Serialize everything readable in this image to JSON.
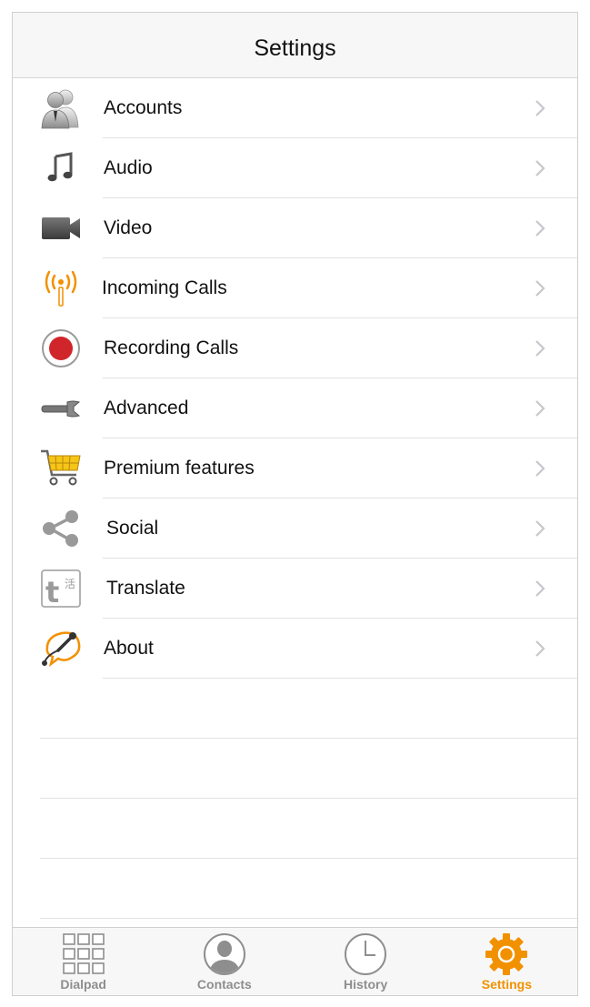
{
  "header": {
    "title": "Settings"
  },
  "menu": {
    "items": [
      {
        "label": "Accounts",
        "icon": "accounts-icon"
      },
      {
        "label": "Audio",
        "icon": "music-note-icon"
      },
      {
        "label": "Video",
        "icon": "video-camera-icon"
      },
      {
        "label": "Incoming Calls",
        "icon": "antenna-icon"
      },
      {
        "label": "Recording Calls",
        "icon": "record-icon"
      },
      {
        "label": "Advanced",
        "icon": "wrench-icon"
      },
      {
        "label": "Premium features",
        "icon": "shopping-cart-icon"
      },
      {
        "label": "Social",
        "icon": "share-icon"
      },
      {
        "label": "Translate",
        "icon": "translate-icon"
      },
      {
        "label": "About",
        "icon": "about-logo-icon"
      }
    ]
  },
  "tabs": [
    {
      "label": "Dialpad",
      "icon": "dialpad-icon"
    },
    {
      "label": "Contacts",
      "icon": "contacts-icon"
    },
    {
      "label": "History",
      "icon": "clock-icon"
    },
    {
      "label": "Settings",
      "icon": "gear-icon",
      "active": true
    }
  ],
  "colors": {
    "accent": "#f29100",
    "inactive": "#8e8e8e",
    "record": "#d0262b"
  }
}
